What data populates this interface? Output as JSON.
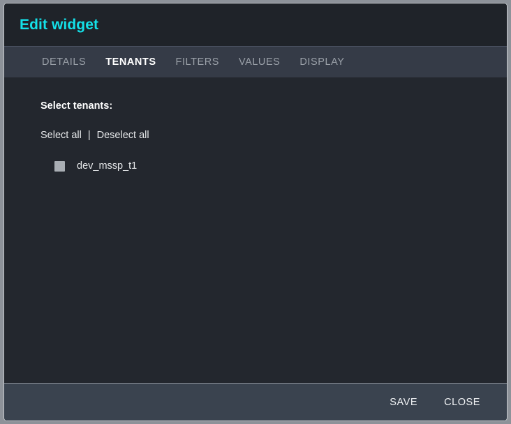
{
  "dialog": {
    "title": "Edit widget",
    "accent_color": "#14e0e8",
    "header_bg": "#1f2329",
    "body_bg": "#23272e",
    "tabbar_bg": "#353b47",
    "footer_bg": "#3a434f"
  },
  "tabs": [
    {
      "label": "DETAILS",
      "active": false
    },
    {
      "label": "TENANTS",
      "active": true
    },
    {
      "label": "FILTERS",
      "active": false
    },
    {
      "label": "VALUES",
      "active": false
    },
    {
      "label": "DISPLAY",
      "active": false
    }
  ],
  "content": {
    "section_label": "Select tenants:",
    "select_all_label": "Select all",
    "separator": "|",
    "deselect_all_label": "Deselect all",
    "tenants": [
      {
        "name": "dev_mssp_t1",
        "checked": false
      }
    ]
  },
  "footer": {
    "save_label": "SAVE",
    "close_label": "CLOSE"
  }
}
